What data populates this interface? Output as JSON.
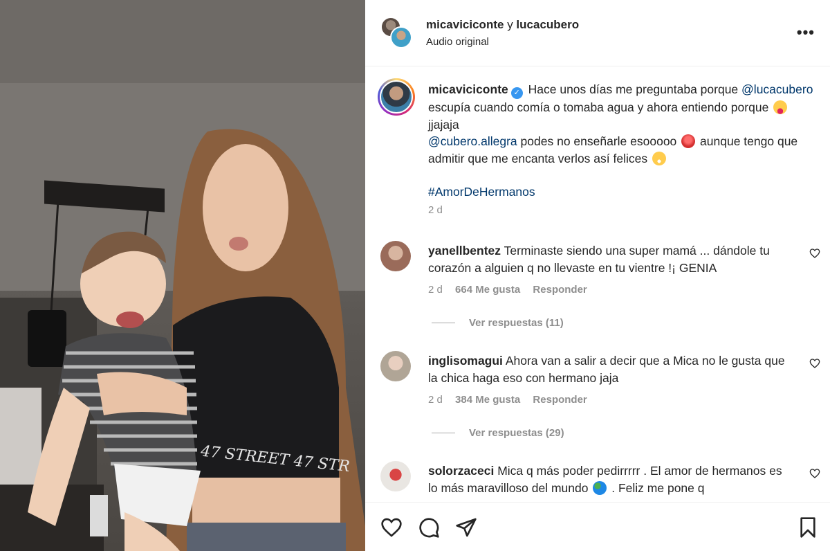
{
  "header": {
    "user1": "micaviciconte",
    "conjunction": "y",
    "user2": "lucacubero",
    "subtitle": "Audio original",
    "more_label": "•••"
  },
  "caption": {
    "username": "micaviciconte",
    "text_1": "Hace unos días me preguntaba porque",
    "mention_1": "@lucacubero",
    "text_2": "escupía cuando comía o tomaba agua y ahora entiendo porque",
    "text_3": "jjajaja",
    "mention_2": "@cubero.allegra",
    "text_4": "podes no enseñarle esooooo",
    "text_5": "aunque tengo que admitir que me encanta verlos así felices",
    "hashtag": "#AmorDeHermanos",
    "time": "2 d"
  },
  "comments": [
    {
      "username": "yanellbentez",
      "text": "Terminaste siendo una super mamá ... dándole tu corazón a alguien q no llevaste en tu vientre !¡ GENIA",
      "time": "2 d",
      "likes": "664 Me gusta",
      "reply": "Responder",
      "view_replies": "Ver respuestas (11)"
    },
    {
      "username": "inglisomagui",
      "text": "Ahora van a salir a decir que a Mica no le gusta que la chica haga eso con hermano jaja",
      "time": "2 d",
      "likes": "384 Me gusta",
      "reply": "Responder",
      "view_replies": "Ver respuestas (29)"
    },
    {
      "username": "solorzaceci",
      "text_1": "Mica q más poder pedirrrrr . El amor de hermanos es lo más maravilloso del mundo",
      "text_2": ". Feliz me pone q"
    }
  ],
  "media": {
    "shirt_text": "47 STREET 47 STR"
  },
  "icons": {
    "like": "heart-icon",
    "comment": "comment-icon",
    "share": "share-icon",
    "save": "bookmark-icon"
  },
  "colors": {
    "link": "#00376b",
    "muted": "#8e8e8e",
    "verified": "#3897f0"
  }
}
